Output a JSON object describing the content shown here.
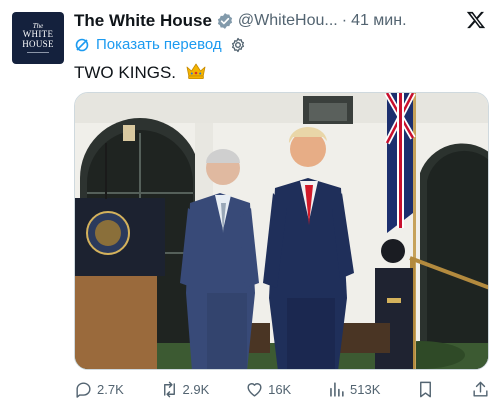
{
  "avatar": {
    "line1": "The",
    "line2": "WHITE",
    "line3": "HOUSE"
  },
  "header": {
    "name": "The White House",
    "handle": "@WhiteHou...",
    "separator": "·",
    "time": "41 мин."
  },
  "translate": {
    "label": "Показать перевод"
  },
  "tweet": {
    "text": "TWO KINGS."
  },
  "actions": {
    "replies": "2.7K",
    "reposts": "2.9K",
    "likes": "16K",
    "views": "513K"
  },
  "colors": {
    "accent": "#1d9bf0",
    "verified": "#829aab",
    "muted": "#536471",
    "avatar_bg": "#14213d"
  },
  "icons": [
    "verified-badge-icon",
    "x-logo-icon",
    "translate-icon",
    "gear-icon",
    "crown-emoji",
    "reply-icon",
    "repost-icon",
    "like-icon",
    "views-icon",
    "bookmark-icon",
    "share-icon"
  ]
}
